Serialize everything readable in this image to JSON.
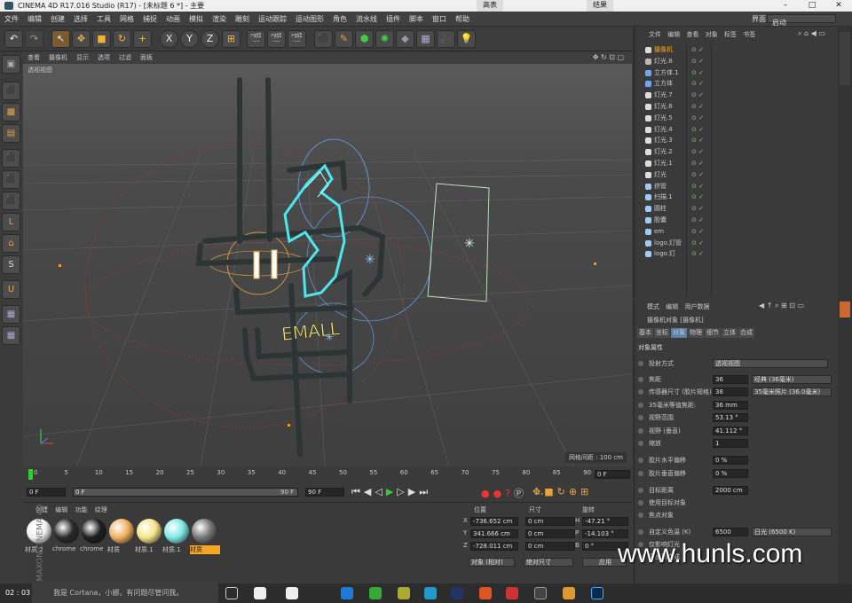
{
  "window": {
    "title": "CINEMA 4D R17.016 Studio (R17) - [未标题 6 *] - 主要",
    "top_tabs": [
      "高表",
      "结果"
    ]
  },
  "menu": [
    "文件",
    "编辑",
    "创建",
    "选择",
    "工具",
    "网格",
    "捕捉",
    "动画",
    "模拟",
    "渲染",
    "雕刻",
    "运动跟踪",
    "运动图形",
    "角色",
    "流水线",
    "插件",
    "脚本",
    "窗口",
    "帮助"
  ],
  "layout": {
    "label": "界面:",
    "value": "启动"
  },
  "toolbar": {
    "x": "X",
    "y": "Y",
    "z": "Z"
  },
  "viewport": {
    "menu": [
      "查看",
      "摄像机",
      "显示",
      "选项",
      "过滤",
      "面板"
    ],
    "label": "透视视图",
    "grid_info": "网格间距 : 100 cm",
    "neon_text": "EMALL"
  },
  "timeline": {
    "ticks": [
      "0",
      "5",
      "10",
      "15",
      "20",
      "25",
      "30",
      "35",
      "40",
      "45",
      "50",
      "55",
      "60",
      "65",
      "70",
      "75",
      "80",
      "85",
      "90"
    ],
    "frame_field": "0 F"
  },
  "controls": {
    "start": "0 F",
    "range_start": "0 F",
    "range_end": "90 F",
    "end": "90 F"
  },
  "materials": {
    "menu": [
      "创建",
      "编辑",
      "功能",
      "纹理"
    ],
    "items": [
      {
        "name": "材质.2",
        "color": "#f2f2f2"
      },
      {
        "name": "chrome",
        "color": "#2a2a2a"
      },
      {
        "name": "chrome",
        "color": "#1e1e1e"
      },
      {
        "name": "材质",
        "color": "#f0b060"
      },
      {
        "name": "材质.1",
        "color": "#f5e58a"
      },
      {
        "name": "材质.1",
        "color": "#7fe8e8"
      },
      {
        "name": "材质",
        "color": "#777777"
      }
    ]
  },
  "coords": {
    "headers": [
      "位置",
      "尺寸",
      "旋转"
    ],
    "rows": [
      {
        "axis": "X",
        "pos": "-736.652 cm",
        "size": "0 cm",
        "rot_axis": "H",
        "rot": "-47.21 °"
      },
      {
        "axis": "Y",
        "pos": "341.666 cm",
        "size": "0 cm",
        "rot_axis": "P",
        "rot": "-14.103 °"
      },
      {
        "axis": "Z",
        "pos": "-728.011 cm",
        "size": "0 cm",
        "rot_axis": "B",
        "rot": "0 °"
      }
    ],
    "mode1": "对象 (相对)",
    "mode2": "绝对尺寸",
    "apply": "应用"
  },
  "object_manager": {
    "menu": [
      "文件",
      "编辑",
      "查看",
      "对象",
      "标签",
      "书签"
    ],
    "objects": [
      "摄像机",
      "灯光.8",
      "立方体.1",
      "立方体",
      "灯光.7",
      "灯光.6",
      "灯光.5",
      "灯光.4",
      "灯光.3",
      "灯光.2",
      "灯光.1",
      "灯光",
      "挤管",
      "扫描.1",
      "圆柱",
      "胶囊",
      "em",
      "logo.灯管",
      "logo.灯"
    ]
  },
  "attributes": {
    "menu": [
      "模式",
      "编辑",
      "用户数据"
    ],
    "object_label": "摄像机对象 [摄像机]",
    "tabs": [
      "基本",
      "坐标",
      "对象",
      "物理",
      "细节",
      "立体",
      "合成"
    ],
    "active_tab": "对象",
    "section": "对象属性",
    "rows": [
      {
        "label": "投射方式",
        "value": "透视视图"
      },
      {
        "label": "焦距",
        "value": "36",
        "extra": "经典 (36毫米)"
      },
      {
        "label": "传感器尺寸 (胶片规格)",
        "value": "36",
        "extra": "35毫米照片 (36.0毫米)"
      },
      {
        "label": "35毫米等值焦距:",
        "value": "36 mm"
      },
      {
        "label": "视野范围",
        "value": "53.13 °"
      },
      {
        "label": "视野 (垂直)",
        "value": "41.112 °"
      },
      {
        "label": "缩放",
        "value": "1"
      },
      {
        "label": "胶片水平偏移",
        "value": "0 %"
      },
      {
        "label": "胶片垂直偏移",
        "value": "0 %"
      },
      {
        "label": "目标距离",
        "value": "2000 cm"
      },
      {
        "label": "使用目标对象",
        "value": ""
      },
      {
        "label": "焦点对象",
        "value": ""
      },
      {
        "label": "自定义色温 (K)",
        "value": "6500",
        "extra": "日光 (6500 K)"
      },
      {
        "label": "仅影响灯光",
        "value": ""
      },
      {
        "label": "导出到合成",
        "value": ""
      }
    ]
  },
  "watermark": "www.hunls.com",
  "taskbar": {
    "time": "02 : 03",
    "search": "我是 Cortana，小娜。有问题尽管问我。"
  }
}
